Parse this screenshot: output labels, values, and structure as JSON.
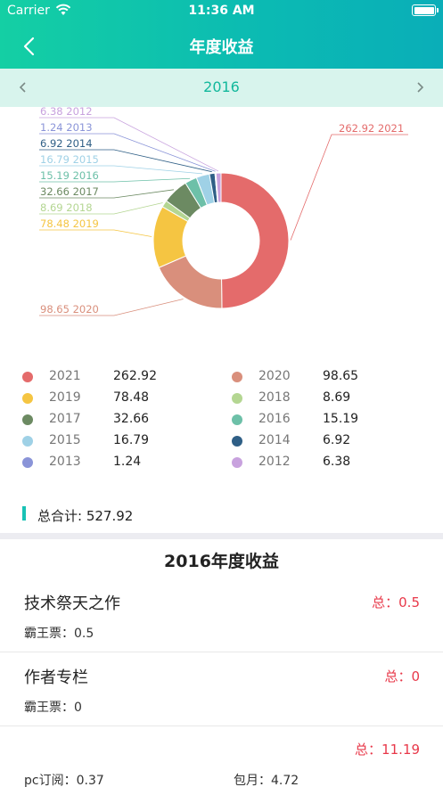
{
  "status": {
    "carrier": "Carrier",
    "time": "11:36 AM"
  },
  "nav": {
    "title": "年度收益"
  },
  "year_selector": {
    "year": "2016"
  },
  "chart_data": {
    "type": "pie",
    "categories": [
      "2021",
      "2020",
      "2019",
      "2018",
      "2017",
      "2016",
      "2015",
      "2014",
      "2013",
      "2012"
    ],
    "values": [
      262.92,
      98.65,
      78.48,
      8.69,
      32.66,
      15.19,
      16.79,
      6.92,
      1.24,
      6.38
    ],
    "colors": [
      "#e46b6b",
      "#d98f7c",
      "#f5c542",
      "#b4d692",
      "#6c8a62",
      "#6dc0a8",
      "#9fd1e6",
      "#2f5f86",
      "#8a94d8",
      "#c8a2de"
    ],
    "labels": [
      "262.92 2021",
      "98.65 2020",
      "78.48 2019",
      "8.69 2018",
      "32.66 2017",
      "15.19 2016",
      "16.79 2015",
      "6.92 2014",
      "1.24 2013",
      "6.38 2012"
    ],
    "donut": true
  },
  "legend": [
    {
      "year": "2021",
      "value": "262.92",
      "color": "#e46b6b"
    },
    {
      "year": "2020",
      "value": "98.65",
      "color": "#d98f7c"
    },
    {
      "year": "2019",
      "value": "78.48",
      "color": "#f5c542"
    },
    {
      "year": "2018",
      "value": "8.69",
      "color": "#b4d692"
    },
    {
      "year": "2017",
      "value": "32.66",
      "color": "#6c8a62"
    },
    {
      "year": "2016",
      "value": "15.19",
      "color": "#6dc0a8"
    },
    {
      "year": "2015",
      "value": "16.79",
      "color": "#9fd1e6"
    },
    {
      "year": "2014",
      "value": "6.92",
      "color": "#2f5f86"
    },
    {
      "year": "2013",
      "value": "1.24",
      "color": "#8a94d8"
    },
    {
      "year": "2012",
      "value": "6.38",
      "color": "#c8a2de"
    }
  ],
  "summary": {
    "total_text": "总合计: 527.92"
  },
  "section": {
    "title": "2016年度收益"
  },
  "rows": [
    {
      "name": "技术祭天之作",
      "total": "总：0.5",
      "detail1": "霸王票：0.5"
    },
    {
      "name": "作者专栏",
      "total": "总：0",
      "detail1": "霸王票：0"
    },
    {
      "name": "",
      "total": "总：11.19",
      "detail1": "pc订阅：0.37",
      "detail2": "包月：4.72"
    }
  ],
  "theme": {
    "accent": "#12b89c",
    "alert": "#e8394a"
  }
}
